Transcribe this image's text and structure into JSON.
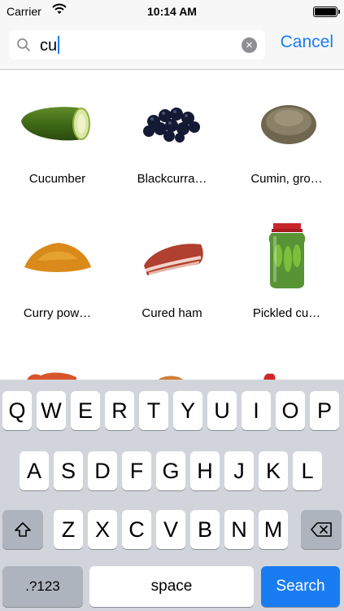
{
  "status_bar": {
    "carrier": "Carrier",
    "time": "10:14 AM"
  },
  "search": {
    "query": "cu",
    "cancel_label": "Cancel"
  },
  "results": [
    {
      "label": "Cucumber",
      "image": "cucumber"
    },
    {
      "label": "Blackcurra…",
      "image": "blackcurrants"
    },
    {
      "label": "Cumin, gro…",
      "image": "cumin"
    },
    {
      "label": "Curry pow…",
      "image": "curry-powder"
    },
    {
      "label": "Cured ham",
      "image": "cured-ham"
    },
    {
      "label": "Pickled cu…",
      "image": "pickled-cucumbers"
    }
  ],
  "keyboard": {
    "row1": [
      "Q",
      "W",
      "E",
      "R",
      "T",
      "Y",
      "U",
      "I",
      "O",
      "P"
    ],
    "row2": [
      "A",
      "S",
      "D",
      "F",
      "G",
      "H",
      "J",
      "K",
      "L"
    ],
    "row3": [
      "Z",
      "X",
      "C",
      "V",
      "B",
      "N",
      "M"
    ],
    "numbers_label": ".?123",
    "space_label": "space",
    "search_label": "Search",
    "shift_icon": "shift-icon",
    "delete_icon": "delete-icon"
  },
  "colors": {
    "accent": "#1a7cf3",
    "keyboard_bg": "#d1d5db"
  }
}
